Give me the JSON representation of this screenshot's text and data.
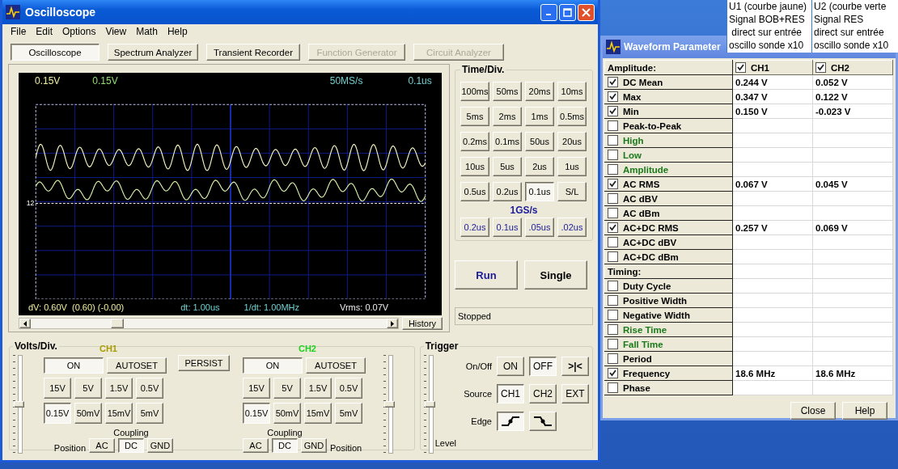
{
  "scope_window": {
    "title": "Oscilloscope"
  },
  "menu": [
    "File",
    "Edit",
    "Options",
    "View",
    "Math",
    "Help"
  ],
  "modes": [
    {
      "label": "Oscilloscope",
      "selected": true,
      "disabled": false
    },
    {
      "label": "Spectrum Analyzer",
      "selected": false,
      "disabled": false
    },
    {
      "label": "Transient Recorder",
      "selected": false,
      "disabled": false
    },
    {
      "label": "Function Generator",
      "selected": false,
      "disabled": true
    },
    {
      "label": "Circuit Analyzer",
      "selected": false,
      "disabled": true
    }
  ],
  "display": {
    "top_labels": [
      {
        "text": "0.15V",
        "color": "#f0f0a0"
      },
      {
        "text": "0.15V",
        "color": "#90e070"
      },
      {
        "text": "50MS/s",
        "color": "#70d0d0"
      },
      {
        "text": "0.1us",
        "color": "#70d0d0"
      }
    ],
    "marker": "12",
    "readouts": [
      {
        "text": "dV: 0.60V  (0.60) (-0.00)",
        "color": "#f0f0a0"
      },
      {
        "text": "dt: 1.00us",
        "color": "#70d0d0"
      },
      {
        "text": "1/dt: 1.00MHz",
        "color": "#70d0d0"
      },
      {
        "text": "Vrms: 0.07V",
        "color": "#f0f0f0"
      }
    ]
  },
  "history_button": "History",
  "time_div": {
    "title": "Time/Div.",
    "buttons": [
      {
        "label": "100ms",
        "selected": false
      },
      {
        "label": "50ms",
        "selected": false
      },
      {
        "label": "20ms",
        "selected": false
      },
      {
        "label": "10ms",
        "selected": false
      },
      {
        "label": "5ms",
        "selected": false
      },
      {
        "label": "2ms",
        "selected": false
      },
      {
        "label": "1ms",
        "selected": false
      },
      {
        "label": "0.5ms",
        "selected": false
      },
      {
        "label": "0.2ms",
        "selected": false
      },
      {
        "label": "0.1ms",
        "selected": false
      },
      {
        "label": "50us",
        "selected": false
      },
      {
        "label": "20us",
        "selected": false
      },
      {
        "label": "10us",
        "selected": false
      },
      {
        "label": "5us",
        "selected": false
      },
      {
        "label": "2us",
        "selected": false
      },
      {
        "label": "1us",
        "selected": false
      },
      {
        "label": "0.5us",
        "selected": false
      },
      {
        "label": "0.2us",
        "selected": false
      },
      {
        "label": "0.1us",
        "selected": true
      },
      {
        "label": "S/L",
        "selected": false
      }
    ],
    "fast_label": "1GS/s",
    "fast_buttons": [
      {
        "label": "0.2us",
        "selected": false
      },
      {
        "label": "0.1us",
        "selected": false
      },
      {
        "label": ".05us",
        "selected": false
      },
      {
        "label": ".02us",
        "selected": false
      }
    ]
  },
  "run_button": "Run",
  "single_button": "Single",
  "status": "Stopped",
  "volts_div": {
    "title": "Volts/Div.",
    "persist": "PERSIST",
    "channels": [
      {
        "name": "CH1",
        "color": "#a89c00",
        "on": {
          "label": "ON",
          "selected": true
        },
        "autoset": "AUTOSET",
        "volts": [
          {
            "label": "15V",
            "selected": false
          },
          {
            "label": "5V",
            "selected": false
          },
          {
            "label": "1.5V",
            "selected": false
          },
          {
            "label": "0.5V",
            "selected": false
          },
          {
            "label": "0.15V",
            "selected": true
          },
          {
            "label": "50mV",
            "selected": false
          },
          {
            "label": "15mV",
            "selected": false
          },
          {
            "label": "5mV",
            "selected": false
          }
        ],
        "coupling_label": "Coupling",
        "coupling": [
          {
            "label": "AC",
            "selected": false
          },
          {
            "label": "DC",
            "selected": true
          },
          {
            "label": "GND",
            "selected": false
          }
        ],
        "position_label": "Position",
        "level": 0.5
      },
      {
        "name": "CH2",
        "color": "#20d020",
        "on": {
          "label": "ON",
          "selected": true
        },
        "autoset": "AUTOSET",
        "volts": [
          {
            "label": "15V",
            "selected": false
          },
          {
            "label": "5V",
            "selected": false
          },
          {
            "label": "1.5V",
            "selected": false
          },
          {
            "label": "0.5V",
            "selected": false
          },
          {
            "label": "0.15V",
            "selected": true
          },
          {
            "label": "50mV",
            "selected": false
          },
          {
            "label": "15mV",
            "selected": false
          },
          {
            "label": "5mV",
            "selected": false
          }
        ],
        "coupling_label": "Coupling",
        "coupling": [
          {
            "label": "AC",
            "selected": false
          },
          {
            "label": "DC",
            "selected": true
          },
          {
            "label": "GND",
            "selected": false
          }
        ],
        "position_label": "Position",
        "level": 0.5
      }
    ]
  },
  "trigger": {
    "title": "Trigger",
    "onoff_label": "On/Off",
    "onoff": [
      {
        "label": "ON",
        "selected": false
      },
      {
        "label": "OFF",
        "selected": true
      }
    ],
    "center_button": ">|<",
    "source_label": "Source",
    "sources": [
      {
        "label": "CH1",
        "selected": true
      },
      {
        "label": "CH2",
        "selected": false
      },
      {
        "label": "EXT",
        "selected": false
      }
    ],
    "edge_label": "Edge",
    "edges": [
      {
        "kind": "rising",
        "selected": true
      },
      {
        "kind": "falling",
        "selected": false
      }
    ],
    "level_label": "Level",
    "level": 0.5
  },
  "notes": [
    [
      "U1 (courbe jaune)",
      "Signal BOB+RES",
      " direct sur entrée",
      "oscillo sonde x10"
    ],
    [
      "U2 (courbe verte",
      "Signal RES",
      "direct sur entrée",
      "oscillo sonde x10"
    ]
  ],
  "params_window": {
    "title": "Waveform Parameter",
    "header": "Amplitude:",
    "columns": [
      {
        "label": "CH1",
        "checked": true
      },
      {
        "label": "CH2",
        "checked": true
      }
    ],
    "rows": [
      {
        "kind": "param",
        "label": "DC  Mean",
        "checked": true,
        "values": [
          "0.244 V",
          "0.052 V"
        ]
      },
      {
        "kind": "param",
        "label": "Max",
        "checked": true,
        "values": [
          "0.347 V",
          "0.122 V"
        ]
      },
      {
        "kind": "param",
        "label": "Min",
        "checked": true,
        "values": [
          "0.150 V",
          "-0.023 V"
        ]
      },
      {
        "kind": "param",
        "label": "Peak-to-Peak",
        "checked": false
      },
      {
        "kind": "param",
        "label": "High",
        "checked": false,
        "color": "#1a7a1a"
      },
      {
        "kind": "param",
        "label": "Low",
        "checked": false,
        "color": "#1a7a1a"
      },
      {
        "kind": "param",
        "label": "Amplitude",
        "checked": false,
        "color": "#1a7a1a"
      },
      {
        "kind": "param",
        "label": "AC RMS",
        "checked": true,
        "values": [
          "0.067 V",
          "0.045 V"
        ]
      },
      {
        "kind": "param",
        "label": "AC dBV",
        "checked": false
      },
      {
        "kind": "param",
        "label": "AC dBm",
        "checked": false
      },
      {
        "kind": "param",
        "label": "AC+DC RMS",
        "checked": true,
        "values": [
          "0.257 V",
          "0.069 V"
        ]
      },
      {
        "kind": "param",
        "label": "AC+DC dBV",
        "checked": false
      },
      {
        "kind": "param",
        "label": "AC+DC dBm",
        "checked": false
      },
      {
        "kind": "section",
        "label": "Timing:"
      },
      {
        "kind": "param",
        "label": "Duty Cycle",
        "checked": false
      },
      {
        "kind": "param",
        "label": "Positive Width",
        "checked": false
      },
      {
        "kind": "param",
        "label": "Negative Width",
        "checked": false
      },
      {
        "kind": "param",
        "label": "Rise Time",
        "checked": false,
        "color": "#1a7a1a"
      },
      {
        "kind": "param",
        "label": "Fall Time",
        "checked": false,
        "color": "#1a7a1a"
      },
      {
        "kind": "param",
        "label": "Period",
        "checked": false
      },
      {
        "kind": "param",
        "label": "Frequency",
        "checked": true,
        "values": [
          "18.6 MHz",
          "18.6 MHz"
        ]
      },
      {
        "kind": "param",
        "label": "Phase",
        "checked": false
      }
    ],
    "buttons": [
      "Close",
      "Help"
    ]
  }
}
